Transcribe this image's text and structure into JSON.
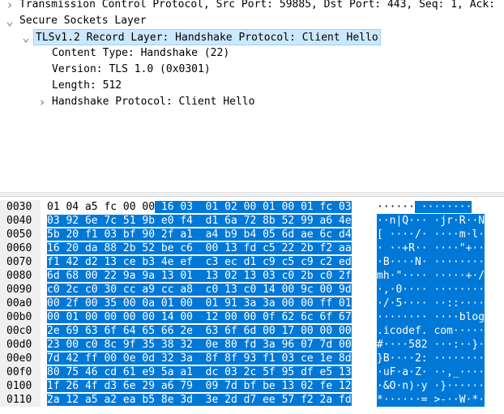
{
  "tree": {
    "rows": [
      {
        "text": "Transmission Control Protocol, Src Port: 59885, Dst Port: 443, Seq: 1, Ack:",
        "expander": "right",
        "indent": 0
      },
      {
        "text": "Secure Sockets Layer",
        "expander": "down",
        "indent": 0
      },
      {
        "text": "TLSv1.2 Record Layer: Handshake Protocol: Client Hello",
        "expander": "down",
        "indent": 1,
        "selected": true
      },
      {
        "text": "Content Type: Handshake (22)",
        "expander": "none",
        "indent": 2
      },
      {
        "text": "Version: TLS 1.0 (0x0301)",
        "expander": "none",
        "indent": 2
      },
      {
        "text": "Length: 512",
        "expander": "none",
        "indent": 2
      },
      {
        "text": "Handshake Protocol: Client Hello",
        "expander": "right",
        "indent": 2
      }
    ]
  },
  "hex": {
    "rows": [
      {
        "offset": "0030",
        "bytes": [
          "01",
          "04",
          "a5",
          "fc",
          "00",
          "00",
          "16",
          "03",
          "01",
          "02",
          "00",
          "01",
          "00",
          "01",
          "fc",
          "03"
        ],
        "ascii": "······ ········",
        "hl_from": 6
      },
      {
        "offset": "0040",
        "bytes": [
          "03",
          "92",
          "6e",
          "7c",
          "51",
          "9b",
          "e0",
          "f4",
          "d1",
          "6a",
          "72",
          "8b",
          "52",
          "99",
          "a6",
          "4e"
        ],
        "ascii": "··n|Q··· ·jr·R··N",
        "hl_from": 0
      },
      {
        "offset": "0050",
        "bytes": [
          "5b",
          "20",
          "f1",
          "03",
          "bf",
          "90",
          "2f",
          "a1",
          "a4",
          "b9",
          "b4",
          "05",
          "6d",
          "ae",
          "6c",
          "d4"
        ],
        "ascii": "[ ····/· ····m·l·",
        "hl_from": 0
      },
      {
        "offset": "0060",
        "bytes": [
          "16",
          "20",
          "da",
          "88",
          "2b",
          "52",
          "be",
          "c6",
          "00",
          "13",
          "fd",
          "c5",
          "22",
          "2b",
          "f2",
          "aa"
        ],
        "ascii": "· ··+R·· ····\"+··",
        "hl_from": 0
      },
      {
        "offset": "0070",
        "bytes": [
          "f1",
          "42",
          "d2",
          "13",
          "ce",
          "b3",
          "4e",
          "ef",
          "c3",
          "ec",
          "d1",
          "c9",
          "c5",
          "c9",
          "c2",
          "ed"
        ],
        "ascii": "·B····N· ········",
        "hl_from": 0
      },
      {
        "offset": "0080",
        "bytes": [
          "6d",
          "68",
          "00",
          "22",
          "9a",
          "9a",
          "13",
          "01",
          "13",
          "02",
          "13",
          "03",
          "c0",
          "2b",
          "c0",
          "2f"
        ],
        "ascii": "mh·\"···· ·····+·/",
        "hl_from": 0
      },
      {
        "offset": "0090",
        "bytes": [
          "c0",
          "2c",
          "c0",
          "30",
          "cc",
          "a9",
          "cc",
          "a8",
          "c0",
          "13",
          "c0",
          "14",
          "00",
          "9c",
          "00",
          "9d"
        ],
        "ascii": "·,·0···· ········",
        "hl_from": 0
      },
      {
        "offset": "00a0",
        "bytes": [
          "00",
          "2f",
          "00",
          "35",
          "00",
          "0a",
          "01",
          "00",
          "01",
          "91",
          "3a",
          "3a",
          "00",
          "00",
          "ff",
          "01"
        ],
        "ascii": "·/·5···· ··::····",
        "hl_from": 0
      },
      {
        "offset": "00b0",
        "bytes": [
          "00",
          "01",
          "00",
          "00",
          "00",
          "00",
          "14",
          "00",
          "12",
          "00",
          "00",
          "0f",
          "62",
          "6c",
          "6f",
          "67"
        ],
        "ascii": "········ ····blog",
        "hl_from": 0
      },
      {
        "offset": "00c0",
        "bytes": [
          "2e",
          "69",
          "63",
          "6f",
          "64",
          "65",
          "66",
          "2e",
          "63",
          "6f",
          "6d",
          "00",
          "17",
          "00",
          "00",
          "00"
        ],
        "ascii": ".icodef. com·····",
        "hl_from": 0
      },
      {
        "offset": "00d0",
        "bytes": [
          "23",
          "00",
          "c0",
          "8c",
          "9f",
          "35",
          "38",
          "32",
          "0e",
          "80",
          "fd",
          "3a",
          "96",
          "07",
          "7d",
          "00"
        ],
        "ascii": "#····582 ···:··}·",
        "hl_from": 0
      },
      {
        "offset": "00e0",
        "bytes": [
          "7d",
          "42",
          "ff",
          "00",
          "0e",
          "0d",
          "32",
          "3a",
          "8f",
          "8f",
          "93",
          "f1",
          "03",
          "ce",
          "1e",
          "8d"
        ],
        "ascii": "}B····2: ········",
        "hl_from": 0
      },
      {
        "offset": "00f0",
        "bytes": [
          "80",
          "75",
          "46",
          "cd",
          "61",
          "e9",
          "5a",
          "a1",
          "dc",
          "03",
          "2c",
          "5f",
          "95",
          "df",
          "e5",
          "13"
        ],
        "ascii": "·uF·a·Z· ··,_····",
        "hl_from": 0
      },
      {
        "offset": "0100",
        "bytes": [
          "1f",
          "26",
          "4f",
          "d3",
          "6e",
          "29",
          "a6",
          "79",
          "09",
          "7d",
          "bf",
          "be",
          "13",
          "02",
          "fe",
          "12"
        ],
        "ascii": "·&O·n)·y ·}······",
        "hl_from": 0
      },
      {
        "offset": "0110",
        "bytes": [
          "2a",
          "12",
          "a5",
          "a2",
          "ea",
          "b5",
          "8e",
          "3d",
          "3e",
          "2d",
          "d7",
          "ee",
          "57",
          "f2",
          "2a",
          "fd"
        ],
        "ascii": "*······= >-··W·*·",
        "hl_from": 0
      }
    ]
  }
}
